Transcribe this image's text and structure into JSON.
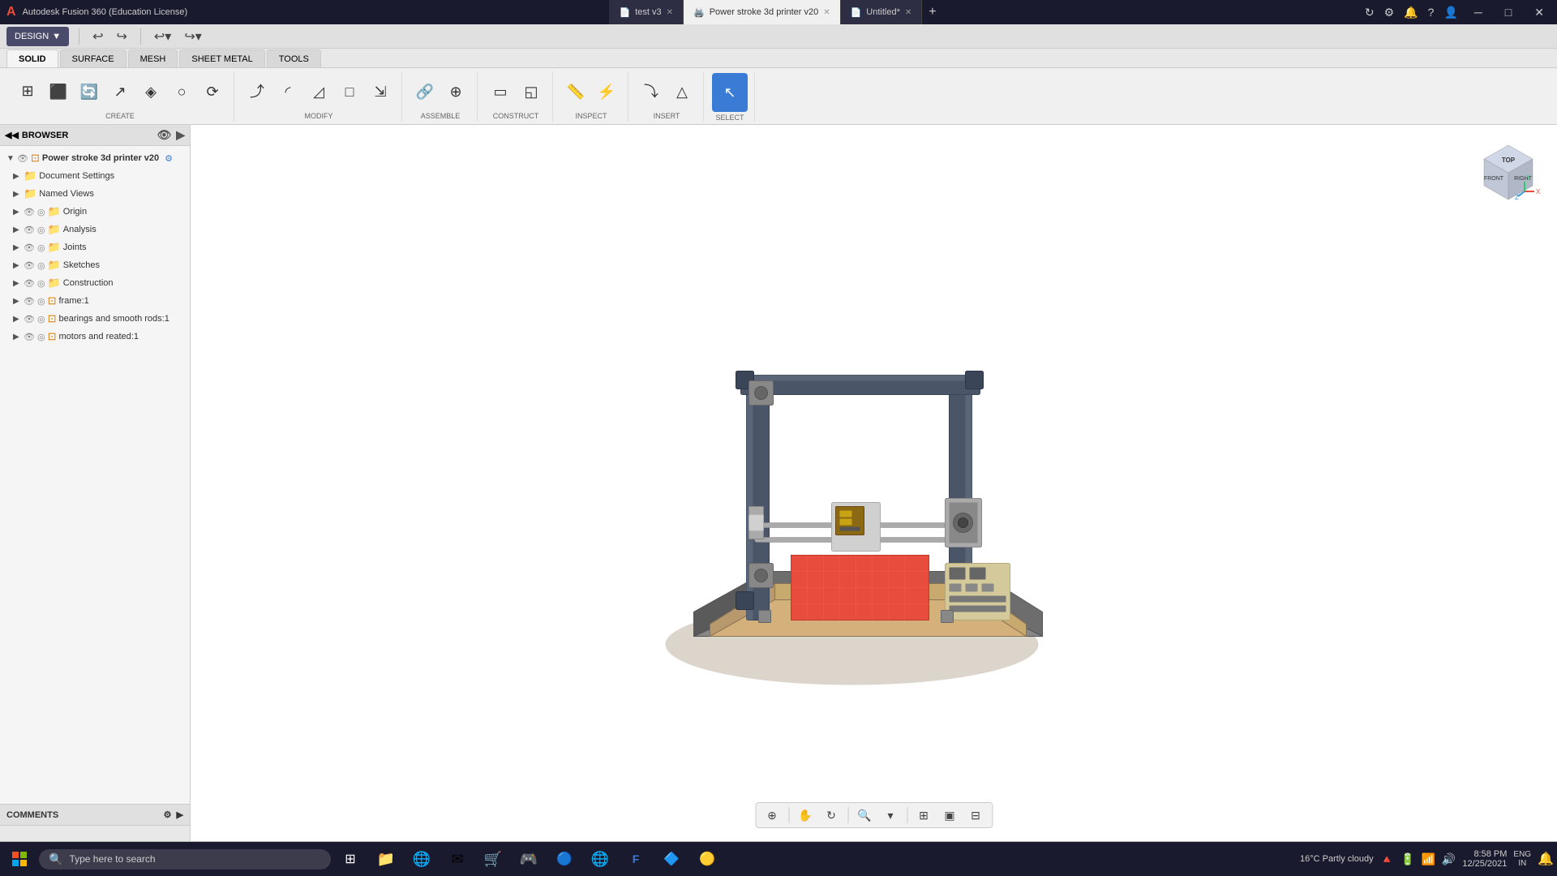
{
  "app": {
    "title": "Autodesk Fusion 360 (Education License)"
  },
  "tabs": [
    {
      "id": "test",
      "label": "test v3",
      "active": false,
      "icon": "📄"
    },
    {
      "id": "printer",
      "label": "Power stroke 3d printer v20",
      "active": true,
      "icon": "🖨️"
    },
    {
      "id": "untitled",
      "label": "Untitled*",
      "active": false,
      "icon": "📄"
    }
  ],
  "toolbar": {
    "design_label": "DESIGN",
    "mode_tabs": [
      "SOLID",
      "SURFACE",
      "MESH",
      "SHEET METAL",
      "TOOLS"
    ],
    "active_mode": "SOLID",
    "groups": {
      "create": {
        "label": "CREATE"
      },
      "modify": {
        "label": "MODIFY"
      },
      "assemble": {
        "label": "ASSEMBLE"
      },
      "construct": {
        "label": "CONSTRUCT"
      },
      "inspect": {
        "label": "INSPECT"
      },
      "insert": {
        "label": "INSERT"
      },
      "select": {
        "label": "SELECT"
      }
    }
  },
  "browser": {
    "title": "BROWSER",
    "document_name": "Power stroke 3d printer v20",
    "items": [
      {
        "id": "doc-settings",
        "label": "Document Settings",
        "indent": 1,
        "expanded": false,
        "type": "folder"
      },
      {
        "id": "named-views",
        "label": "Named Views",
        "indent": 1,
        "expanded": false,
        "type": "folder"
      },
      {
        "id": "origin",
        "label": "Origin",
        "indent": 1,
        "expanded": false,
        "type": "folder",
        "visible": true
      },
      {
        "id": "analysis",
        "label": "Analysis",
        "indent": 1,
        "expanded": false,
        "type": "folder",
        "visible": true
      },
      {
        "id": "joints",
        "label": "Joints",
        "indent": 1,
        "expanded": false,
        "type": "folder",
        "visible": true
      },
      {
        "id": "sketches",
        "label": "Sketches",
        "indent": 1,
        "expanded": false,
        "type": "folder",
        "visible": true
      },
      {
        "id": "construction",
        "label": "Construction",
        "indent": 1,
        "expanded": false,
        "type": "folder",
        "visible": true
      },
      {
        "id": "frame",
        "label": "frame:1",
        "indent": 1,
        "expanded": false,
        "type": "component",
        "visible": true
      },
      {
        "id": "bearings",
        "label": "bearings and smooth rods:1",
        "indent": 1,
        "expanded": false,
        "type": "component",
        "visible": true
      },
      {
        "id": "motors",
        "label": "motors and reated:1",
        "indent": 1,
        "expanded": false,
        "type": "component",
        "visible": true
      }
    ]
  },
  "comments": {
    "title": "COMMENTS"
  },
  "viewport_toolbar": {
    "tools": [
      "⊕",
      "⊞",
      "✋",
      "↻",
      "🔍",
      "▣",
      "⊟",
      "⊞"
    ]
  },
  "animation_toolbar": {
    "play_controls": [
      "⏮",
      "⏪",
      "⏹",
      "▶",
      "⏩",
      "⏭"
    ]
  },
  "taskbar": {
    "search_placeholder": "Type here to search",
    "time": "8:58 PM",
    "date": "12/25/2021",
    "temperature": "16°C  Partly cloudy",
    "language": "ENG\nIN"
  }
}
